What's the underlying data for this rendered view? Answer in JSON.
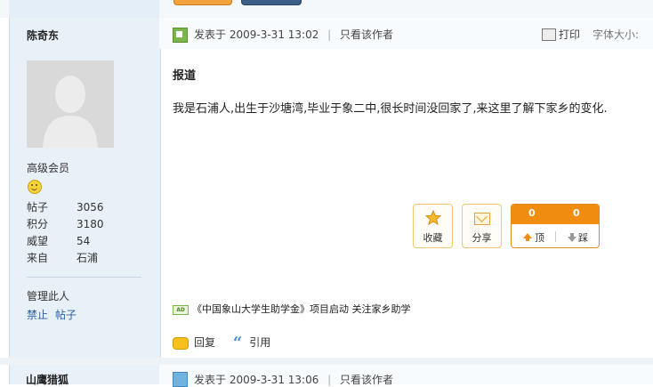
{
  "post": {
    "author": "陈奇东",
    "rank": "高级会员",
    "stats": [
      {
        "label": "帖子",
        "value": "3056"
      },
      {
        "label": "积分",
        "value": "3180"
      },
      {
        "label": "威望",
        "value": "54"
      },
      {
        "label": "来自",
        "value": "石浦"
      }
    ],
    "manage_label": "管理此人",
    "manage_links": [
      "禁止",
      "帖子"
    ],
    "posted_prefix": "发表于",
    "posted_time": "2009-3-31 13:02",
    "only_author": "只看该作者",
    "print_label": "打印",
    "font_size_label": "字体大小:",
    "title": "报道",
    "content": "我是石浦人,出生于沙塘湾,毕业于象二中,很长时间没回家了,来这里了解下家乡的变化.",
    "actions": {
      "favorite": "收藏",
      "share": "分享",
      "up_count": "0",
      "down_count": "0",
      "up_label": "顶",
      "down_label": "踩"
    },
    "ad_badge": "AD",
    "ad_text": "《中国象山大学生助学金》项目启动 关注家乡助学",
    "reply_label": "回复",
    "quote_label": "引用"
  },
  "next_post": {
    "author": "山鹰猎狐",
    "posted_prefix": "发表于",
    "posted_time": "2009-3-31 13:06",
    "only_author": "只看该作者"
  },
  "colors": {
    "sidebar_bg": "#e8f0f8",
    "accent_orange": "#f08c10",
    "link_blue": "#2b60a3"
  }
}
